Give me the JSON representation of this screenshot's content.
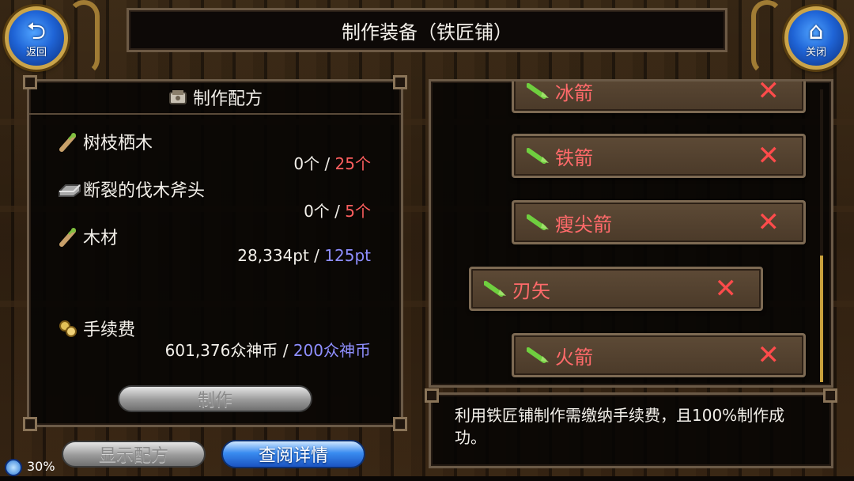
{
  "header": {
    "title": "制作装备（铁匠铺）",
    "back_label": "返回",
    "close_label": "关闭"
  },
  "recipe": {
    "title": "制作配方",
    "materials": [
      {
        "name": "树枝栖木",
        "have": "0个",
        "need": "25个",
        "icon": "branch-icon"
      },
      {
        "name": "断裂的伐木斧头",
        "have": "0个",
        "need": "5个",
        "icon": "ingot-icon"
      },
      {
        "name": "木材",
        "have": "28,334pt",
        "need": "125pt",
        "icon": "branch-icon"
      }
    ],
    "fee": {
      "label": "手续费",
      "have": "601,376众神币",
      "need": "200众神币",
      "icon": "coins-icon"
    },
    "make_label": "制作"
  },
  "buttons": {
    "show_recipe": "显示配方",
    "view_details": "查阅详情"
  },
  "arrow_list": [
    {
      "name": "冰箭",
      "icon": "arrow-icon",
      "status_icon": "cross-icon"
    },
    {
      "name": "铁箭",
      "icon": "arrow-icon",
      "status_icon": "cross-icon"
    },
    {
      "name": "瘦尖箭",
      "icon": "arrow-icon",
      "status_icon": "cross-icon"
    },
    {
      "name": "刃矢",
      "icon": "arrow-icon",
      "status_icon": "cross-icon"
    },
    {
      "name": "火箭",
      "icon": "arrow-icon",
      "status_icon": "cross-icon"
    }
  ],
  "description": "利用铁匠铺制作需缴纳手续费，且100%制作成功。",
  "status": {
    "battery": "30%"
  },
  "colors": {
    "need_red": "#ff5f5f",
    "need_blue": "#8f8fff",
    "item_red": "#ff6a6a",
    "accent_gold": "#c9a13c"
  }
}
